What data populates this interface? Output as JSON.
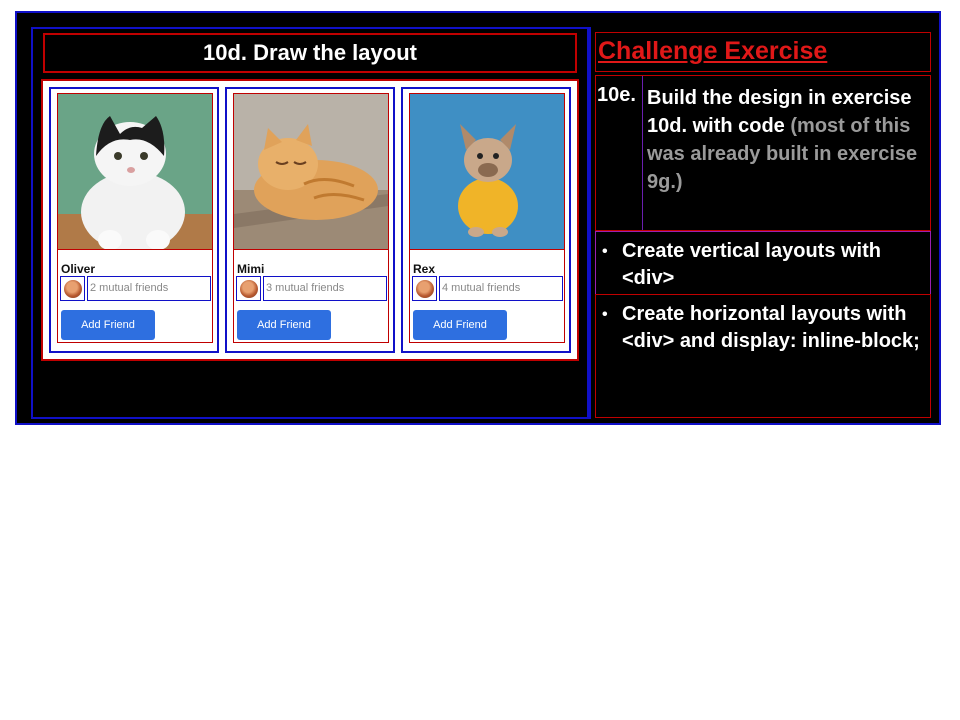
{
  "slide": {
    "title": "10d. Draw the layout",
    "cards": [
      {
        "name": "Oliver",
        "friends": "2 mutual friends",
        "button": "Add Friend"
      },
      {
        "name": "Mimi",
        "friends": "3 mutual friends",
        "button": "Add Friend"
      },
      {
        "name": "Rex",
        "friends": "4 mutual friends",
        "button": "Add Friend"
      }
    ],
    "challenge": {
      "title": "Challenge Exercise",
      "exercise_number": "10e.",
      "exercise_text": "Build the design in exercise 10d. with code",
      "exercise_note": "(most of this was already built in exercise 9g.)",
      "bullets": [
        "Create vertical layouts with <div>",
        "Create horizontal layouts with <div> and display: inline-block;"
      ]
    }
  },
  "colors": {
    "frame_blue": "#1010c8",
    "box_red": "#c00000",
    "title_red": "#e01818",
    "button_blue": "#2e6fe0"
  },
  "icons": [
    "cat-photo",
    "cat-photo",
    "dog-photo",
    "avatar-icon"
  ]
}
